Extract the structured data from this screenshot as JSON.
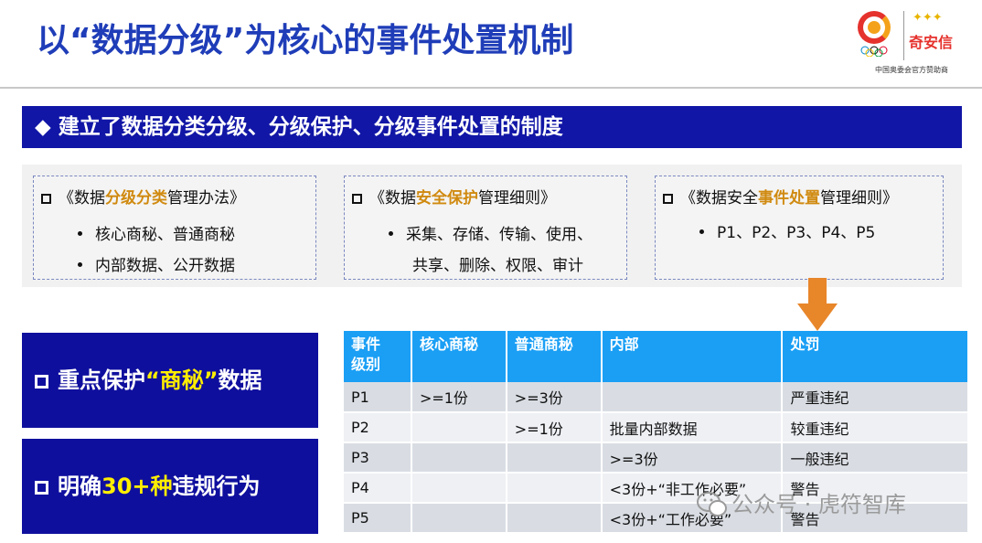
{
  "header": {
    "title": "以“数据分级”为核心的事件处置机制",
    "logo": {
      "brand": "奇安信",
      "caption": "中国奥委会官方赞助商",
      "icon": "qianxin-olympic-logo"
    }
  },
  "banner": {
    "text": "◆ 建立了数据分类分级、分级保护、分级事件处置的制度"
  },
  "panels": [
    {
      "title_pre": "《数据",
      "title_hl": "分级分类",
      "title_post": "管理办法》",
      "bullets": [
        "核心商秘、普通商秘",
        "内部数据、公开数据"
      ]
    },
    {
      "title_pre": "《数据",
      "title_hl": "安全保护",
      "title_post": "管理细则》",
      "bullets": [
        "采集、存储、传输、使用、",
        "共享、删除、权限、审计"
      ]
    },
    {
      "title_pre": "《数据安全",
      "title_hl": "事件处置",
      "title_post": "管理细则》",
      "bullets": [
        "P1、P2、P3、P4、P5"
      ]
    }
  ],
  "left_boxes": [
    {
      "pre": "重点保护",
      "hl": "“商秘”",
      "post": "数据"
    },
    {
      "pre": "明确",
      "hl": "30+种",
      "post": "违规行为"
    }
  ],
  "table": {
    "headers": [
      "事件级别",
      "核心商秘",
      "普通商秘",
      "内部",
      "处罚"
    ],
    "rows": [
      [
        "P1",
        ">=1份",
        ">=3份",
        "",
        "严重违纪"
      ],
      [
        "P2",
        "",
        ">=1份",
        "批量内部数据",
        "较重违纪"
      ],
      [
        "P3",
        "",
        "",
        ">=3份",
        "一般违纪"
      ],
      [
        "P4",
        "",
        "",
        "<3份+“非工作必要”",
        "警告"
      ],
      [
        "P5",
        "",
        "",
        "<3份+“工作必要”",
        "警告"
      ]
    ]
  },
  "watermark": {
    "text": "公众号 · 虎符智库",
    "icon": "wechat-icon"
  },
  "colors": {
    "title": "#1f3db8",
    "banner": "#1116a6",
    "highlight_orange": "#d08a10",
    "highlight_yellow": "#ffee00",
    "table_header": "#1a9ff5",
    "arrow": "#e8862a"
  }
}
